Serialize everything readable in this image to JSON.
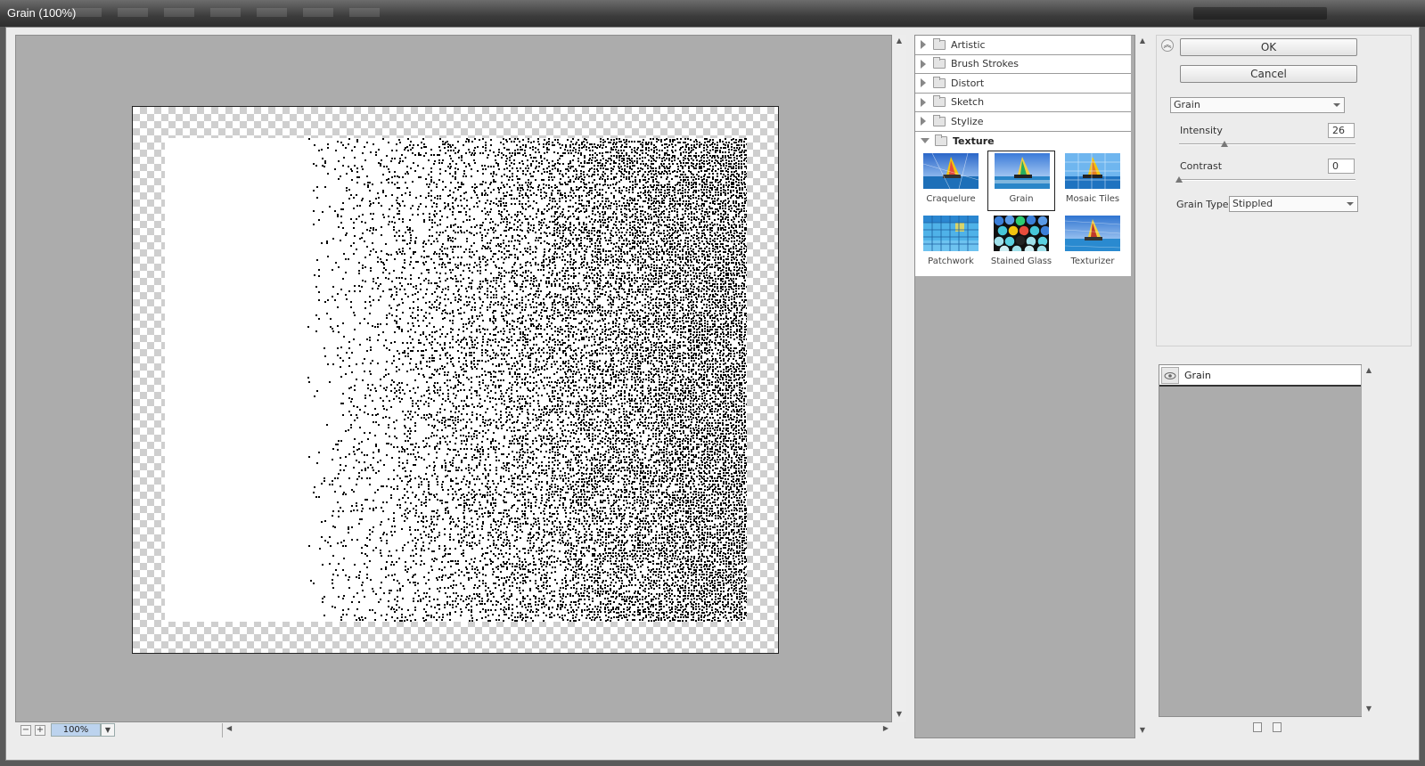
{
  "window": {
    "title": "Grain (100%)"
  },
  "preview": {
    "zoom": "100%",
    "zoom_out_symbol": "−",
    "zoom_in_symbol": "+"
  },
  "gallery": {
    "categories": [
      {
        "label": "Artistic",
        "expanded": false
      },
      {
        "label": "Brush Strokes",
        "expanded": false
      },
      {
        "label": "Distort",
        "expanded": false
      },
      {
        "label": "Sketch",
        "expanded": false
      },
      {
        "label": "Stylize",
        "expanded": false
      },
      {
        "label": "Texture",
        "expanded": true
      }
    ],
    "thumbnails": [
      {
        "label": "Craquelure",
        "selected": false
      },
      {
        "label": "Grain",
        "selected": true
      },
      {
        "label": "Mosaic Tiles",
        "selected": false
      },
      {
        "label": "Patchwork",
        "selected": false
      },
      {
        "label": "Stained Glass",
        "selected": false
      },
      {
        "label": "Texturizer",
        "selected": false
      }
    ]
  },
  "controls": {
    "ok_label": "OK",
    "cancel_label": "Cancel",
    "filter_select": "Grain",
    "intensity": {
      "label": "Intensity",
      "value": "26",
      "max": 100
    },
    "contrast": {
      "label": "Contrast",
      "value": "0",
      "max": 100
    },
    "grain_type": {
      "label": "Grain Type:",
      "value": "Stippled"
    }
  },
  "layers": {
    "items": [
      {
        "label": "Grain"
      }
    ]
  },
  "colors": {
    "canvas_gray": "#acacac",
    "zoom_highlight": "#bcd3ee"
  }
}
